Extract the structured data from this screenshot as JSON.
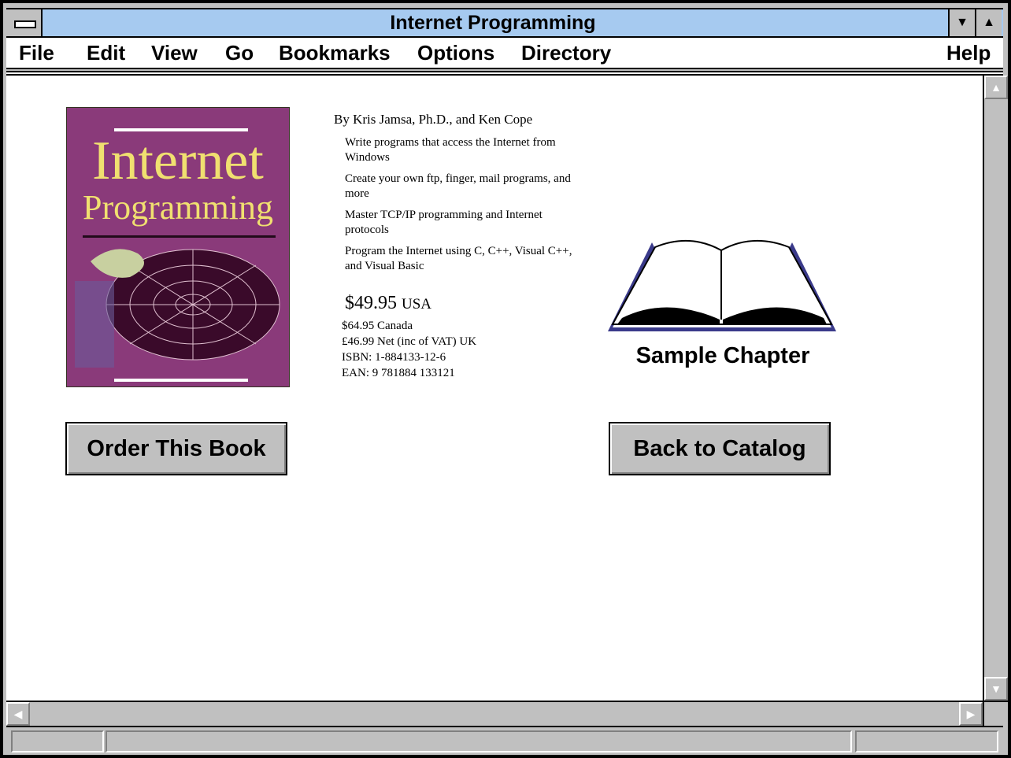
{
  "window": {
    "title": "Internet Programming"
  },
  "menus": [
    "File",
    "Edit",
    "View",
    "Go",
    "Bookmarks",
    "Options",
    "Directory",
    "Help"
  ],
  "cover": {
    "title_line1": "Internet",
    "title_line2": "Programming"
  },
  "book": {
    "author": "By Kris Jamsa, Ph.D., and Ken Cope",
    "features": [
      "Write programs that access the Internet from Windows",
      "Create your own ftp, finger, mail programs, and more",
      "Master TCP/IP programming and Internet protocols",
      "Program the Internet using C, C++, Visual C++, and Visual Basic"
    ],
    "price_usa": "$49.95",
    "price_usa_suffix": "USA",
    "price_canada": "$64.95 Canada",
    "price_uk": "£46.99 Net (inc of VAT) UK",
    "isbn": "ISBN: 1-884133-12-6",
    "ean": "EAN: 9 781884 133121"
  },
  "sample_chapter_label": "Sample Chapter",
  "buttons": {
    "order": "Order This Book",
    "back": "Back to Catalog"
  },
  "colors": {
    "titlebar": "#a6caf0",
    "chrome": "#c0c0c0",
    "cover": "#8a3a7a",
    "book_icon": "#3a3a8a"
  }
}
